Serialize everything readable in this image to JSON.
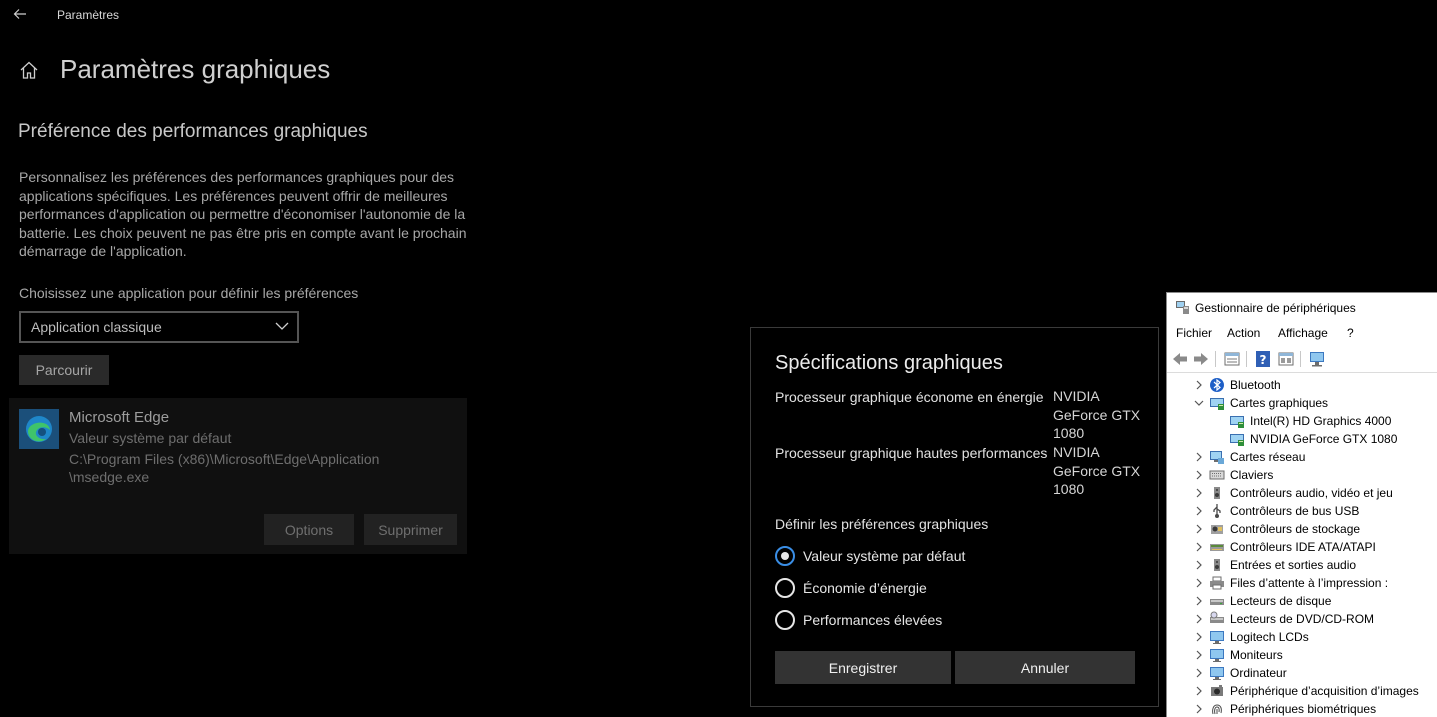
{
  "settings": {
    "window_title": "Paramètres",
    "page_title": "Paramètres graphiques",
    "section_title": "Préférence des performances graphiques",
    "description": "Personnalisez les préférences des performances graphiques pour des applications spécifiques. Les préférences peuvent offrir de meilleures performances d'application ou permettre d'économiser l'autonomie de la batterie. Les choix peuvent ne pas être pris en compte avant le prochain démarrage de l'application.",
    "choose_label": "Choisissez une application pour définir les préférences",
    "app_type_selected": "Application classique",
    "browse_label": "Parcourir",
    "app_card": {
      "name": "Microsoft Edge",
      "preference": "Valeur système par défaut",
      "path_line1": "C:\\Program Files (x86)\\Microsoft\\Edge\\Application",
      "path_line2": "\\msedge.exe",
      "options_label": "Options",
      "delete_label": "Supprimer"
    }
  },
  "dialog": {
    "title": "Spécifications graphiques",
    "specs": [
      {
        "label": "Processeur graphique économe en énergie",
        "value_lines": [
          "NVIDIA",
          "GeForce GTX",
          "1080"
        ]
      },
      {
        "label": "Processeur graphique hautes performances",
        "value_lines": [
          "NVIDIA",
          "GeForce GTX",
          "1080"
        ]
      }
    ],
    "pref_heading": "Définir les préférences graphiques",
    "options": [
      {
        "label": "Valeur système par défaut",
        "checked": true
      },
      {
        "label": "Économie d’énergie",
        "checked": false
      },
      {
        "label": "Performances élevées",
        "checked": false
      }
    ],
    "save_label": "Enregistrer",
    "cancel_label": "Annuler"
  },
  "device_manager": {
    "title": "Gestionnaire de périphériques",
    "menu": [
      "Fichier",
      "Action",
      "Affichage",
      "?"
    ],
    "toolbar_icons": [
      "back-arrow-icon",
      "forward-arrow-icon",
      "properties-icon",
      "help-icon",
      "update-driver-icon",
      "scan-hardware-icon"
    ],
    "tree": [
      {
        "label": "Bluetooth",
        "icon": "bluetooth-icon",
        "expander": "collapsed",
        "level": 0
      },
      {
        "label": "Cartes graphiques",
        "icon": "display-adapter-icon",
        "expander": "expanded",
        "level": 0
      },
      {
        "label": "Intel(R) HD Graphics 4000",
        "icon": "display-adapter-icon",
        "expander": "none",
        "level": 1
      },
      {
        "label": "NVIDIA GeForce GTX 1080",
        "icon": "display-adapter-icon",
        "expander": "none",
        "level": 1
      },
      {
        "label": "Cartes réseau",
        "icon": "network-adapter-icon",
        "expander": "collapsed",
        "level": 0
      },
      {
        "label": "Claviers",
        "icon": "keyboard-icon",
        "expander": "collapsed",
        "level": 0
      },
      {
        "label": "Contrôleurs audio, vidéo et jeu",
        "icon": "speaker-icon",
        "expander": "collapsed",
        "level": 0
      },
      {
        "label": "Contrôleurs de bus USB",
        "icon": "usb-icon",
        "expander": "collapsed",
        "level": 0
      },
      {
        "label": "Contrôleurs de stockage",
        "icon": "storage-controller-icon",
        "expander": "collapsed",
        "level": 0
      },
      {
        "label": "Contrôleurs IDE ATA/ATAPI",
        "icon": "ide-controller-icon",
        "expander": "collapsed",
        "level": 0
      },
      {
        "label": "Entrées et sorties audio",
        "icon": "speaker-icon",
        "expander": "collapsed",
        "level": 0
      },
      {
        "label": "Files d’attente à l’impression :",
        "icon": "printer-icon",
        "expander": "collapsed",
        "level": 0
      },
      {
        "label": "Lecteurs de disque",
        "icon": "disk-drive-icon",
        "expander": "collapsed",
        "level": 0
      },
      {
        "label": "Lecteurs de DVD/CD-ROM",
        "icon": "dvd-drive-icon",
        "expander": "collapsed",
        "level": 0
      },
      {
        "label": "Logitech LCDs",
        "icon": "monitor-icon",
        "expander": "collapsed",
        "level": 0
      },
      {
        "label": "Moniteurs",
        "icon": "monitor-icon",
        "expander": "collapsed",
        "level": 0
      },
      {
        "label": "Ordinateur",
        "icon": "monitor-icon",
        "expander": "collapsed",
        "level": 0
      },
      {
        "label": "Périphérique d’acquisition d’images",
        "icon": "camera-icon",
        "expander": "collapsed",
        "level": 0
      },
      {
        "label": "Périphériques biométriques",
        "icon": "fingerprint-icon",
        "expander": "collapsed",
        "level": 0
      }
    ]
  },
  "colors": {
    "accent": "#3a8ee6",
    "dark_background": "#000000",
    "button_gray": "#333333"
  }
}
